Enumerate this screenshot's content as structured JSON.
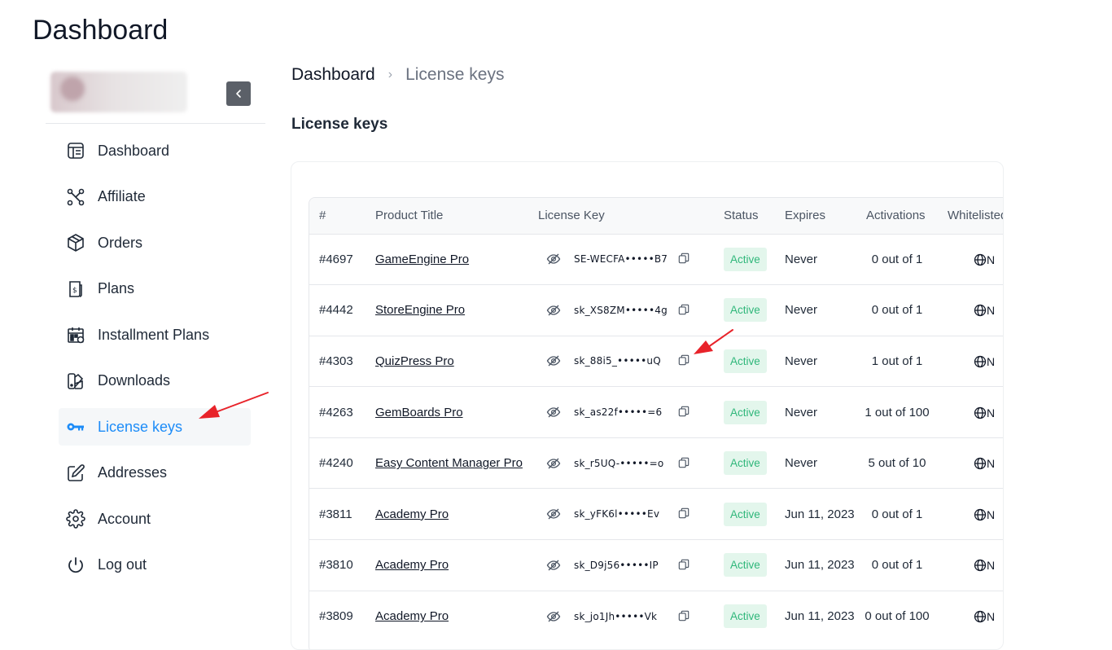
{
  "page": {
    "title": "Dashboard"
  },
  "sidebar": {
    "items": [
      {
        "label": "Dashboard",
        "icon": "dashboard-icon"
      },
      {
        "label": "Affiliate",
        "icon": "affiliate-icon"
      },
      {
        "label": "Orders",
        "icon": "box-icon"
      },
      {
        "label": "Plans",
        "icon": "plans-icon"
      },
      {
        "label": "Installment Plans",
        "icon": "calendar-icon"
      },
      {
        "label": "Downloads",
        "icon": "downloads-icon"
      },
      {
        "label": "License keys",
        "icon": "key-icon",
        "active": true
      },
      {
        "label": "Addresses",
        "icon": "edit-icon"
      },
      {
        "label": "Account",
        "icon": "gear-icon"
      },
      {
        "label": "Log out",
        "icon": "power-icon"
      }
    ]
  },
  "breadcrumb": {
    "home": "Dashboard",
    "separator": "›",
    "current": "License keys"
  },
  "section": {
    "title": "License keys"
  },
  "table": {
    "headers": [
      "#",
      "Product Title",
      "License Key",
      "Status",
      "Expires",
      "Activations",
      "Whitelisted"
    ],
    "rows": [
      {
        "id": "#4697",
        "title": "GameEngine Pro",
        "key": "SE-WECFA•••••B7",
        "status": "Active",
        "expires": "Never",
        "activations": "0 out of 1",
        "whitelist": "N"
      },
      {
        "id": "#4442",
        "title": "StoreEngine Pro",
        "key": "sk_XS8ZM•••••4g",
        "status": "Active",
        "expires": "Never",
        "activations": "0 out of 1",
        "whitelist": "N"
      },
      {
        "id": "#4303",
        "title": "QuizPress Pro",
        "key": "sk_88i5_•••••uQ",
        "status": "Active",
        "expires": "Never",
        "activations": "1 out of 1",
        "whitelist": "N"
      },
      {
        "id": "#4263",
        "title": "GemBoards Pro",
        "key": "sk_as22f•••••=6",
        "status": "Active",
        "expires": "Never",
        "activations": "1 out of 100",
        "whitelist": "N"
      },
      {
        "id": "#4240",
        "title": "Easy Content Manager Pro",
        "key": "sk_r5UQ-•••••=o",
        "status": "Active",
        "expires": "Never",
        "activations": "5 out of 10",
        "whitelist": "N"
      },
      {
        "id": "#3811",
        "title": "Academy Pro",
        "key": "sk_yFK6l•••••Ev",
        "status": "Active",
        "expires": "Jun 11, 2023",
        "activations": "0 out of 1",
        "whitelist": "N"
      },
      {
        "id": "#3810",
        "title": "Academy Pro",
        "key": "sk_D9j56•••••IP",
        "status": "Active",
        "expires": "Jun 11, 2023",
        "activations": "0 out of 1",
        "whitelist": "N"
      },
      {
        "id": "#3809",
        "title": "Academy Pro",
        "key": "sk_jo1Jh•••••Vk",
        "status": "Active",
        "expires": "Jun 11, 2023",
        "activations": "0 out of 100",
        "whitelist": "N"
      }
    ]
  },
  "colors": {
    "accent": "#1d8cf8",
    "annotation": "#e8232a",
    "badge_bg": "#e3f6ec",
    "badge_text": "#2fb77a"
  }
}
